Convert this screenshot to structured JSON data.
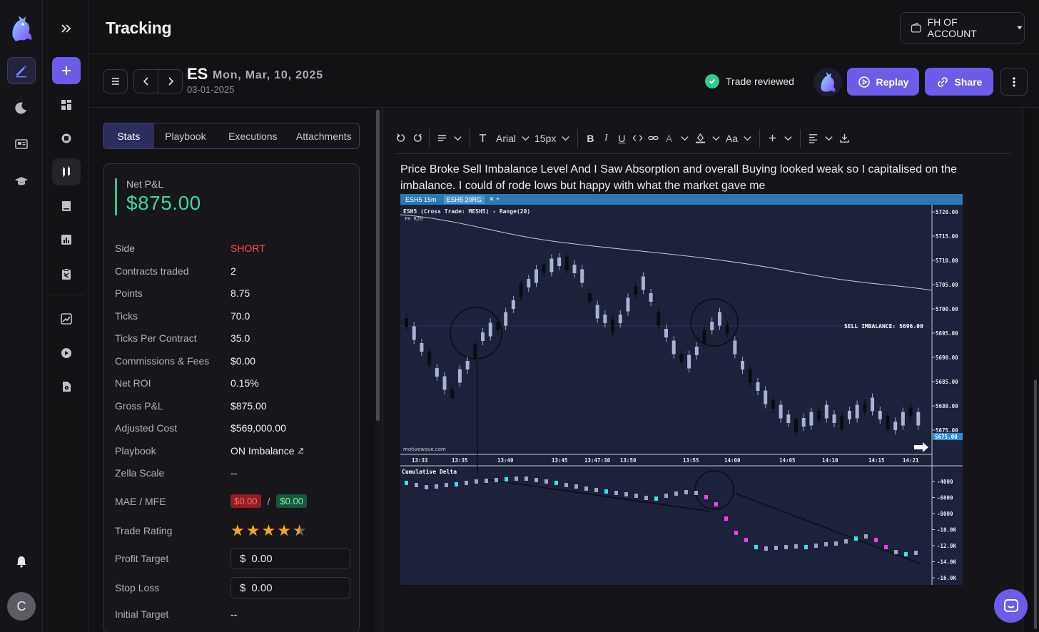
{
  "header": {
    "title": "Tracking",
    "account": "FH OF ACCOUNT"
  },
  "trade": {
    "symbol": "ES",
    "date": "Mon, Mar, 10, 2025",
    "subdate": "03-01-2025",
    "reviewed_label": "Trade reviewed",
    "replay_label": "Replay",
    "share_label": "Share"
  },
  "tabs": [
    "Stats",
    "Playbook",
    "Executions",
    "Attachments"
  ],
  "stats": {
    "net_pnl_label": "Net P&L",
    "net_pnl_value": "$875.00",
    "rows": [
      {
        "k": "Side",
        "v": "SHORT"
      },
      {
        "k": "Contracts traded",
        "v": "2"
      },
      {
        "k": "Points",
        "v": "8.75"
      },
      {
        "k": "Ticks",
        "v": "70.0"
      },
      {
        "k": "Ticks Per Contract",
        "v": "35.0"
      },
      {
        "k": "Commissions & Fees",
        "v": "$0.00"
      },
      {
        "k": "Net ROI",
        "v": "0.15%"
      },
      {
        "k": "Gross P&L",
        "v": "$875.00"
      },
      {
        "k": "Adjusted Cost",
        "v": "$569,000.00"
      },
      {
        "k": "Playbook",
        "v": "ON Imbalance"
      },
      {
        "k": "Zella Scale",
        "v": "--"
      }
    ],
    "mae_mfe_label": "MAE / MFE",
    "mae": "$0.00",
    "mfe": "$0.00",
    "trade_rating_label": "Trade Rating",
    "trade_rating": 4.5,
    "profit_target_label": "Profit Target",
    "profit_target_value": "0.00",
    "stop_loss_label": "Stop Loss",
    "stop_loss_value": "0.00",
    "initial_target_label": "Initial Target",
    "initial_target_value": "--",
    "currency": "$"
  },
  "toolbar": {
    "font": "Arial",
    "size": "15px",
    "case": "Aa"
  },
  "note": "Price Broke Sell Imbalance Level And I Saw Absorption and overall Buying looked weak so I capitalised on the imbalance. I could of rode lows but happy with what the market gave me",
  "chart_image": {
    "tab1": "ESH5 15m",
    "tab2": "ESH5 20RG",
    "title": "ESH5 (Cross Trade: MESH5) - Range(20)",
    "sub": "FH R20",
    "sell_label": "SELL IMBALANCE: 5696.00",
    "last_price": "5675.00",
    "watermark": "motivewave.com",
    "delta_label": "Cumulative Delta",
    "price_ticks": [
      "5720.00",
      "5715.00",
      "5710.00",
      "5705.00",
      "5700.00",
      "5695.00",
      "5690.00",
      "5685.00",
      "5680.00",
      "5675.00"
    ],
    "time_ticks": [
      "13:33",
      "13:35",
      "13:40",
      "13:45",
      "13:47:30",
      "13:50",
      "13:55",
      "14:00",
      "14:05",
      "14:10",
      "14:15",
      "14:21"
    ],
    "delta_ticks": [
      "-4000",
      "-6000",
      "-8000",
      "-10.0K",
      "-12.0K",
      "-14.0K",
      "-16.0K"
    ]
  },
  "colors": {
    "accent": "#6c5ce7",
    "profit": "#3fd79a",
    "short": "#ff4d4d",
    "star": "#f5a524"
  }
}
